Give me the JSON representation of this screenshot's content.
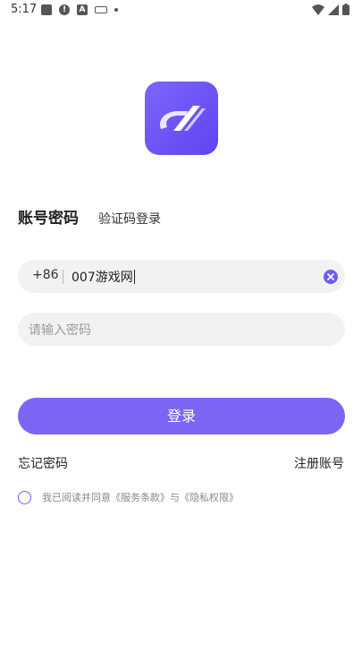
{
  "status_bar": {
    "time": "5:17",
    "alert_glyph": "!",
    "a_glyph": "A"
  },
  "tabs": {
    "account_password": "账号密码",
    "verification_code": "验证码登录"
  },
  "phone": {
    "country_code": "+86",
    "value": "007游戏网"
  },
  "password": {
    "placeholder": "请输入密码"
  },
  "login_button": "登录",
  "links": {
    "forgot_password": "忘记密码",
    "register": "注册账号"
  },
  "agreement": {
    "text": "我已阅读并同意《服务条款》与《隐私权限》",
    "checked": false
  },
  "colors": {
    "accent": "#7a66f3",
    "input_bg": "#f2f2f4"
  },
  "icons": {
    "logo": "app-logo-icon",
    "clear": "clear-icon",
    "wifi": "wifi-icon",
    "signal": "signal-icon",
    "battery": "battery-icon"
  }
}
